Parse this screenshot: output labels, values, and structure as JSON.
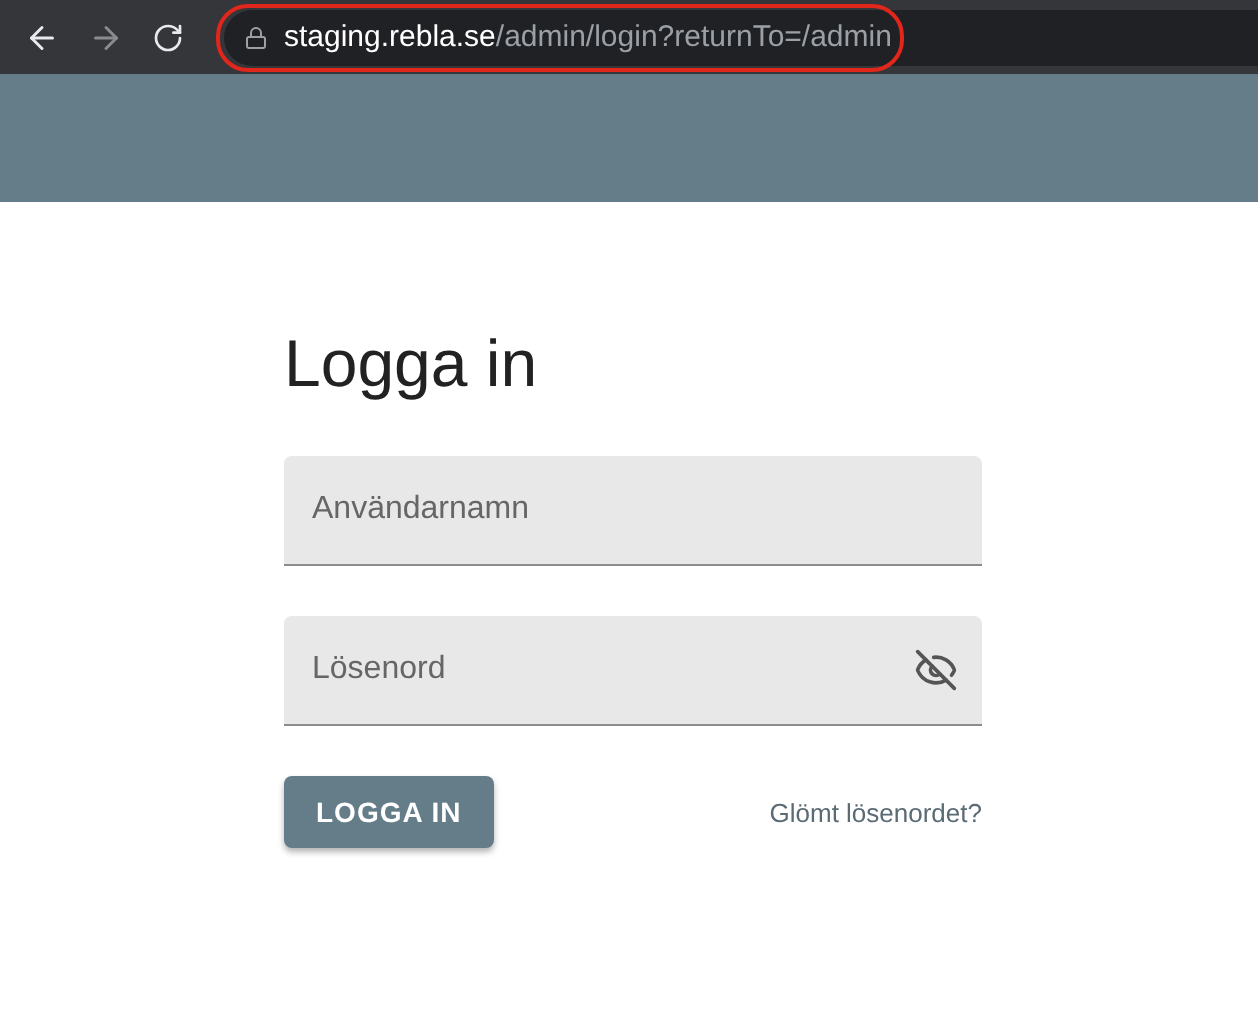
{
  "browser": {
    "url_host": "staging.rebla.se",
    "url_path": "/admin/login?returnTo=/admin",
    "url_highlighted": true
  },
  "login": {
    "title": "Logga in",
    "fields": [
      {
        "kind": "text",
        "placeholder": "Användarnamn"
      },
      {
        "kind": "password",
        "placeholder": "Lösenord",
        "password_visible": false
      }
    ],
    "submit": "LOGGA IN",
    "forgot_link": "Glömt lösenordet?"
  }
}
